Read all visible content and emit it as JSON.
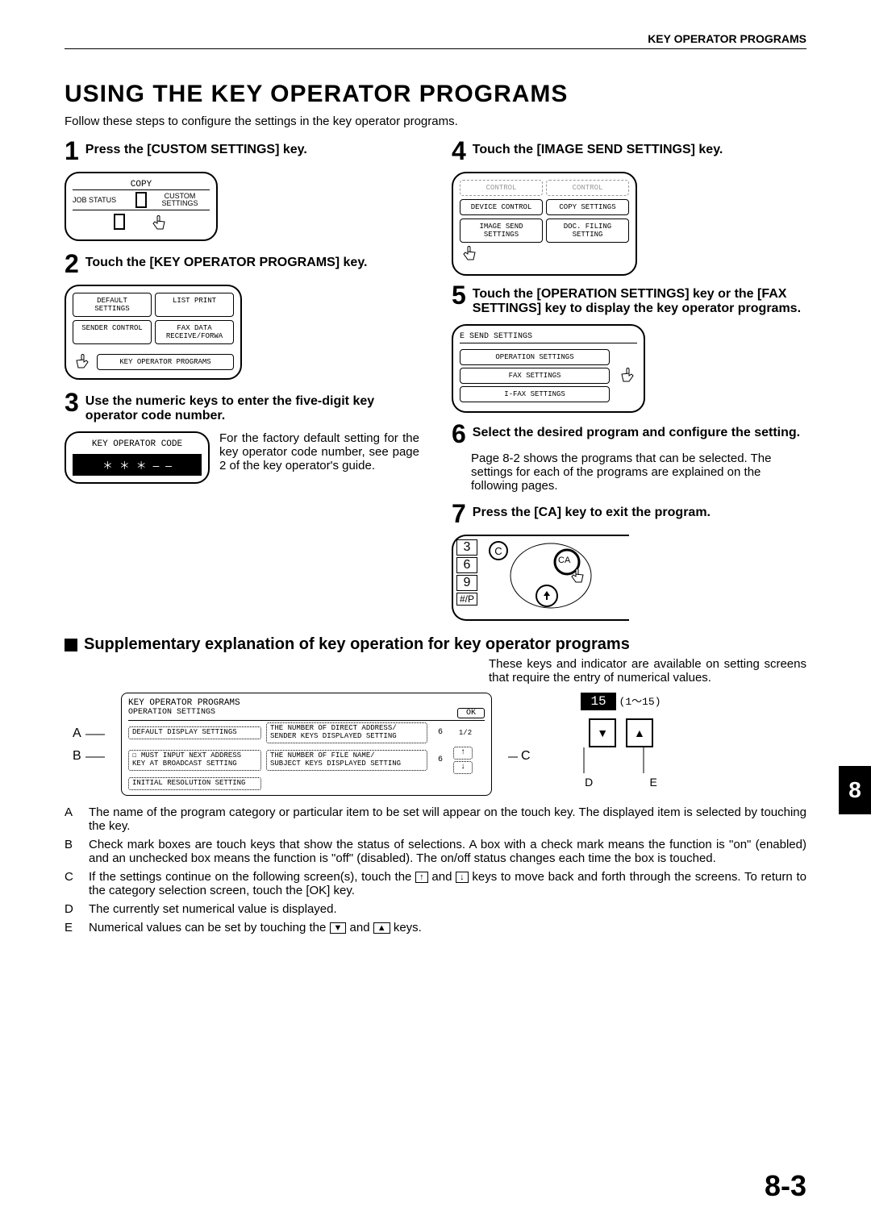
{
  "header": {
    "section": "KEY OPERATOR PROGRAMS"
  },
  "title": "USING THE KEY OPERATOR PROGRAMS",
  "intro": "Follow these steps to configure the settings in the key operator programs.",
  "steps": {
    "s1": {
      "num": "1",
      "title": "Press the [CUSTOM SETTINGS] key."
    },
    "s1fig": {
      "copy": "COPY",
      "job": "JOB STATUS",
      "custom": "CUSTOM\nSETTINGS"
    },
    "s2": {
      "num": "2",
      "title": "Touch the [KEY OPERATOR PROGRAMS] key."
    },
    "s2fig": {
      "a": "DEFAULT\nSETTINGS",
      "b": "LIST PRINT",
      "c": "SENDER CONTROL",
      "d": "FAX DATA\nRECEIVE/FORWA",
      "e": "KEY OPERATOR PROGRAMS"
    },
    "s3": {
      "num": "3",
      "title": "Use the numeric keys to enter the five-digit key operator code number.",
      "code_label": "KEY OPERATOR CODE",
      "mask": "＊ ＊ ＊ — —",
      "body": "For the factory default setting for the key operator code number, see page 2 of the key operator's guide."
    },
    "s4": {
      "num": "4",
      "title": "Touch the [IMAGE SEND SETTINGS] key."
    },
    "s4fig": {
      "a": "CONTROL",
      "b": "CONTROL",
      "c": "DEVICE CONTROL",
      "d": "COPY SETTINGS",
      "e": "IMAGE SEND\nSETTINGS",
      "f": "DOC. FILING\nSETTING"
    },
    "s5": {
      "num": "5",
      "title": "Touch the [OPERATION SETTINGS] key or the [FAX SETTINGS] key to display the key operator programs."
    },
    "s5fig": {
      "head": "E SEND SETTINGS",
      "a": "OPERATION SETTINGS",
      "b": "FAX SETTINGS",
      "c": "I-FAX SETTINGS"
    },
    "s6": {
      "num": "6",
      "title": "Select the desired program and configure the setting.",
      "body": "Page 8-2 shows the programs that can be selected. The settings for each of the programs are explained on the following pages."
    },
    "s7": {
      "num": "7",
      "title": "Press the [CA] key to exit the program."
    },
    "s7fig": {
      "k3": "3",
      "k6": "6",
      "k9": "9",
      "kp": "#/P",
      "ca": "CA"
    }
  },
  "supp": {
    "title": "Supplementary explanation of key operation for key operator programs",
    "para": "These keys and indicator are available on setting screens that require the entry of numerical values.",
    "panel": {
      "head1": "KEY OPERATOR PROGRAMS",
      "head2": "OPERATION SETTINGS",
      "ok": "OK",
      "r1a": "DEFAULT DISPLAY SETTINGS",
      "r1b": "THE NUMBER OF DIRECT ADDRESS/\nSENDER KEYS DISPLAYED SETTING",
      "r1c": "6",
      "page": "1/2",
      "r2a": "MUST INPUT NEXT ADDRESS\nKEY AT BROADCAST SETTING",
      "r2b": "THE NUMBER OF FILE NAME/\nSUBJECT KEYS DISPLAYED SETTING",
      "r2c": "6",
      "r3a": "INITIAL RESOLUTION SETTING"
    },
    "labels": {
      "A": "A",
      "B": "B",
      "C": "C",
      "D": "D",
      "E": "E"
    },
    "numeric": {
      "val": "15",
      "range": "(1～15)"
    },
    "defs": {
      "A": "The name of the program category or particular item to be set will appear on the touch key. The displayed item is selected by touching the key.",
      "B": "Check mark boxes are touch keys that show the status of selections. A box with a check mark means the function is \"on\" (enabled) and an unchecked box means the function is \"off\" (disabled). The on/off status changes each time the box is touched.",
      "C_pre": "If the settings continue on the following screen(s), touch the ",
      "C_post": " keys to move back and forth through the screens. To return to the category selection screen, touch the [OK] key.",
      "C_and": " and ",
      "D": "The currently set numerical value is displayed.",
      "E_pre": "Numerical values can be set by touching the ",
      "E_post": " keys.",
      "E_and": " and "
    }
  },
  "page": {
    "number": "8-3",
    "chapter": "8"
  }
}
